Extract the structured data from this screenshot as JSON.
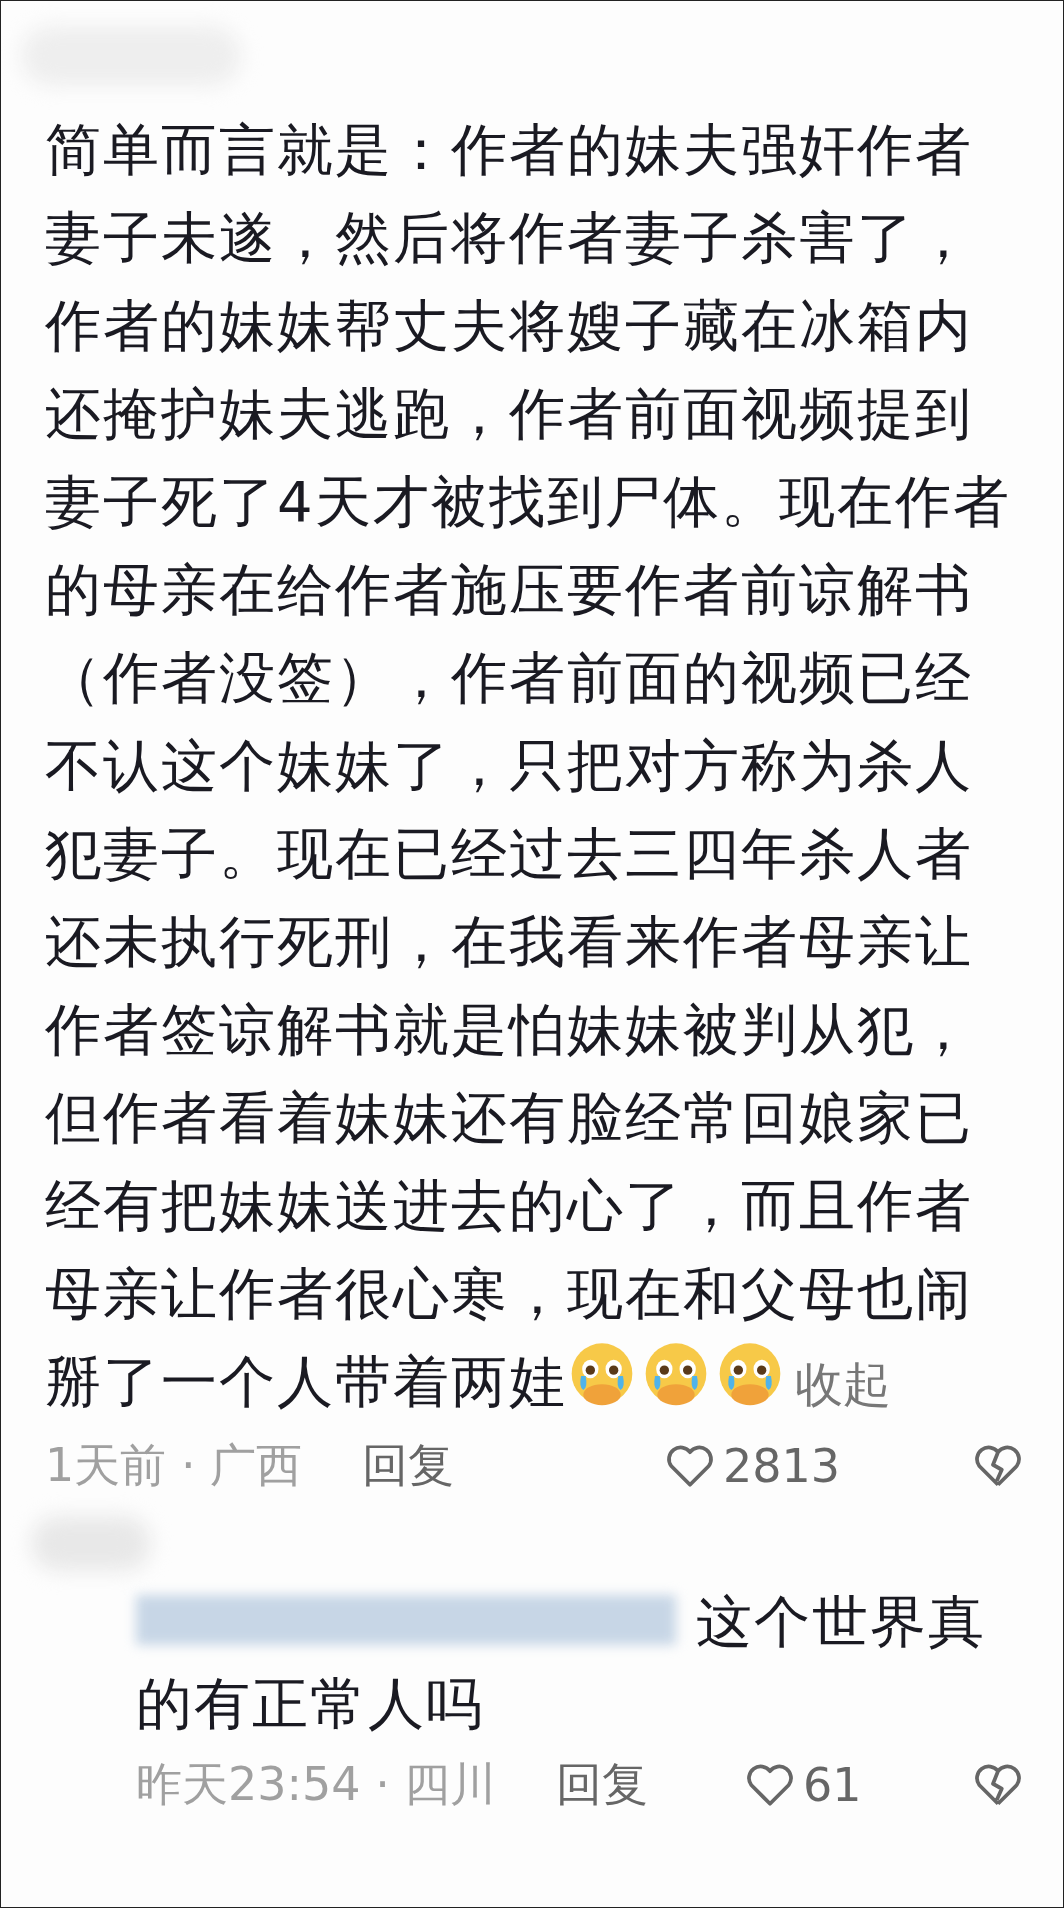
{
  "comments": [
    {
      "kind": "root",
      "text": "简单而言就是：作者的妹夫强奸作者妻子未遂，然后将作者妻子杀害了，作者的妹妹帮丈夫将嫂子藏在冰箱内还掩护妹夫逃跑，作者前面视频提到妻子死了4天才被找到尸体。现在作者的母亲在给作者施压要作者前谅解书（作者没签），作者前面的视频已经不认这个妹妹了，只把对方称为杀人犯妻子。现在已经过去三四年杀人者还未执行死刑，在我看来作者母亲让作者签谅解书就是怕妹妹被判从犯，但作者看着妹妹还有脸经常回娘家已经有把妹妹送进去的心了，而且作者母亲让作者很心寒，现在和父母也闹掰了一个人带着两娃",
      "collapse_link": "收起",
      "meta": "1天前 · 广西",
      "reply": "回复",
      "likes": "2813",
      "liked": false
    },
    {
      "kind": "reply",
      "text": "这个世界真的有正常人吗",
      "meta": "昨天23:54 · 四川",
      "reply": "回复",
      "likes": "61",
      "liked": false
    }
  ]
}
